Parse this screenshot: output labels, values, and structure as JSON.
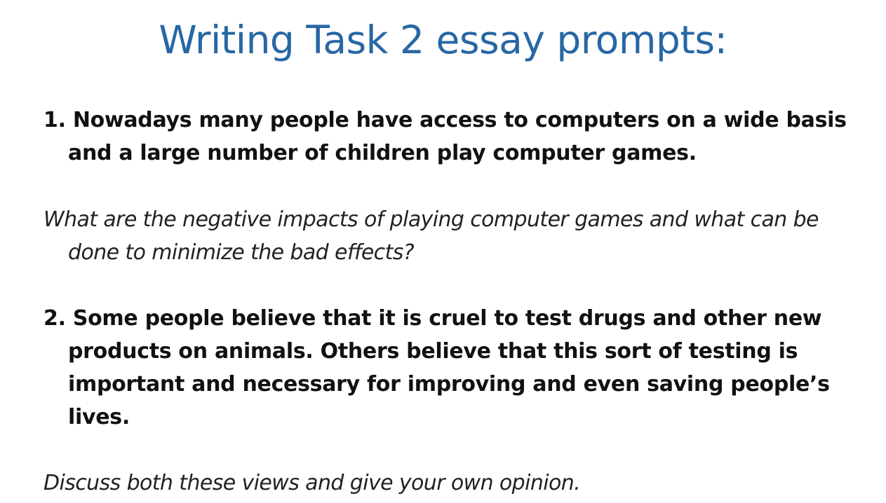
{
  "slide": {
    "title": "Writing Task 2 essay prompts:",
    "prompts": [
      {
        "lines": [
          "1. Nowadays many people have access to computers on a wide basis",
          "and a large number of children play computer games."
        ],
        "question_lines": [
          "What are the negative impacts of playing computer games and what can be",
          "done to minimize the bad effects?"
        ]
      },
      {
        "lines": [
          "2. Some people believe that it is cruel to test drugs and other new",
          "products on animals. Others believe that this sort of testing is",
          "important and necessary for improving and even saving people’s",
          "lives."
        ],
        "question_lines": [
          "Discuss both these views and give your own opinion."
        ]
      }
    ],
    "colors": {
      "title": "#2767a4",
      "text": "#111111"
    }
  }
}
